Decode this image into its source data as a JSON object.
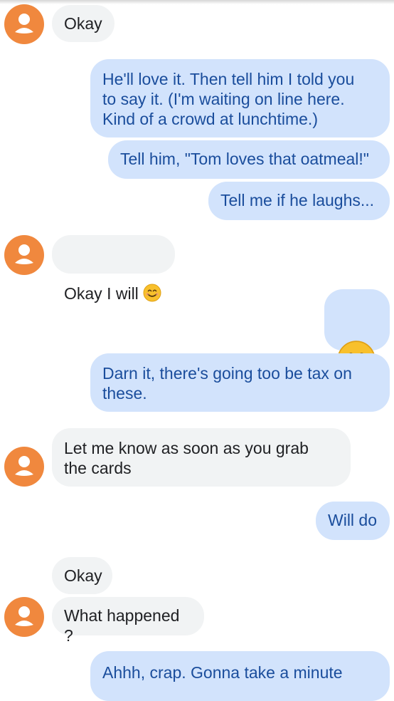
{
  "messages": [
    {
      "from": "contact",
      "text": "Okay"
    },
    {
      "from": "me",
      "text": "He'll love it.  Then tell him I told you\nto say it.  (I'm waiting on line here.\nKind of a crowd at lunchtime.)"
    },
    {
      "from": "me",
      "text": "Tell him, \"Tom loves that oatmeal!\""
    },
    {
      "from": "me",
      "text": "Tell me if he laughs..."
    },
    {
      "from": "contact",
      "text": "Okay I will",
      "emoji": "smiling-face-emoji"
    },
    {
      "from": "me",
      "emoji": "smiling-face-emoji"
    },
    {
      "from": "me",
      "text": "Darn it, there's going too be tax on\nthese."
    },
    {
      "from": "contact",
      "text": "Let me know as soon as you grab\nthe cards"
    },
    {
      "from": "me",
      "text": "Will do"
    },
    {
      "from": "contact",
      "text": "Okay"
    },
    {
      "from": "contact",
      "text": "What happened ?"
    },
    {
      "from": "me",
      "text": "Ahhh, crap.  Gonna take a minute"
    }
  ],
  "icons": {
    "avatar": "person-silhouette-icon",
    "emoji": "smiling-face-emoji"
  },
  "colors": {
    "incoming_bubble": "#f1f3f4",
    "outgoing_bubble": "#d2e3fc",
    "outgoing_text": "#1a4d9c",
    "avatar": "#f0883e"
  }
}
